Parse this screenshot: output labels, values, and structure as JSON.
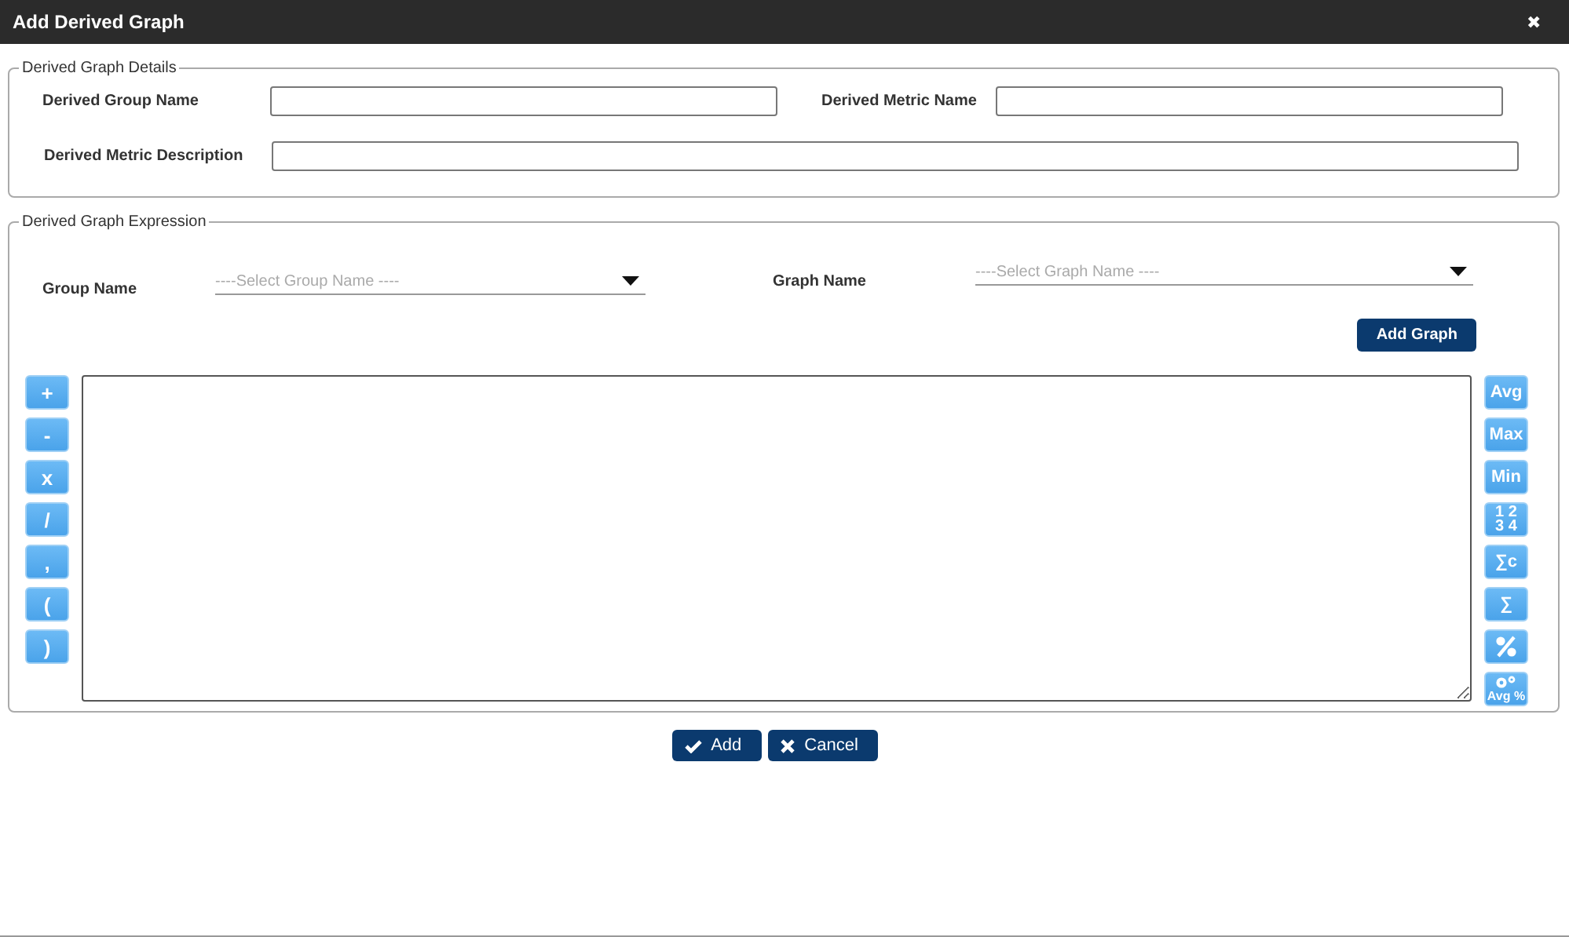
{
  "window": {
    "title": "Add Derived Graph",
    "close": "✖"
  },
  "details": {
    "legend": "Derived Graph Details",
    "fields": [
      {
        "label": "Derived Group Name"
      },
      {
        "label": "Derived Metric Name"
      },
      {
        "label": "Derived Metric Description"
      }
    ]
  },
  "expression": {
    "legend": "Derived Graph Expression",
    "group_select": {
      "label": "Group Name",
      "placeholder": "----Select Group Name ----"
    },
    "graph_select": {
      "label": "Graph Name",
      "placeholder": "----Select Graph Name ----"
    },
    "add_graph": "Add Graph",
    "operators": [
      "+",
      "-",
      "x",
      "/",
      ",",
      "(",
      ")"
    ],
    "functions": [
      {
        "kind": "text",
        "label": "Avg"
      },
      {
        "kind": "text",
        "label": "Max"
      },
      {
        "kind": "text",
        "label": "Min"
      },
      {
        "kind": "stack",
        "lines": [
          "1 2",
          "3 4"
        ]
      },
      {
        "kind": "text",
        "label": "∑c"
      },
      {
        "kind": "text",
        "label": "∑"
      },
      {
        "kind": "percent"
      },
      {
        "kind": "gear",
        "label": "Avg %"
      }
    ]
  },
  "buttons": [
    {
      "kind": "check",
      "label": "Add"
    },
    {
      "kind": "cross",
      "label": "Cancel"
    }
  ]
}
